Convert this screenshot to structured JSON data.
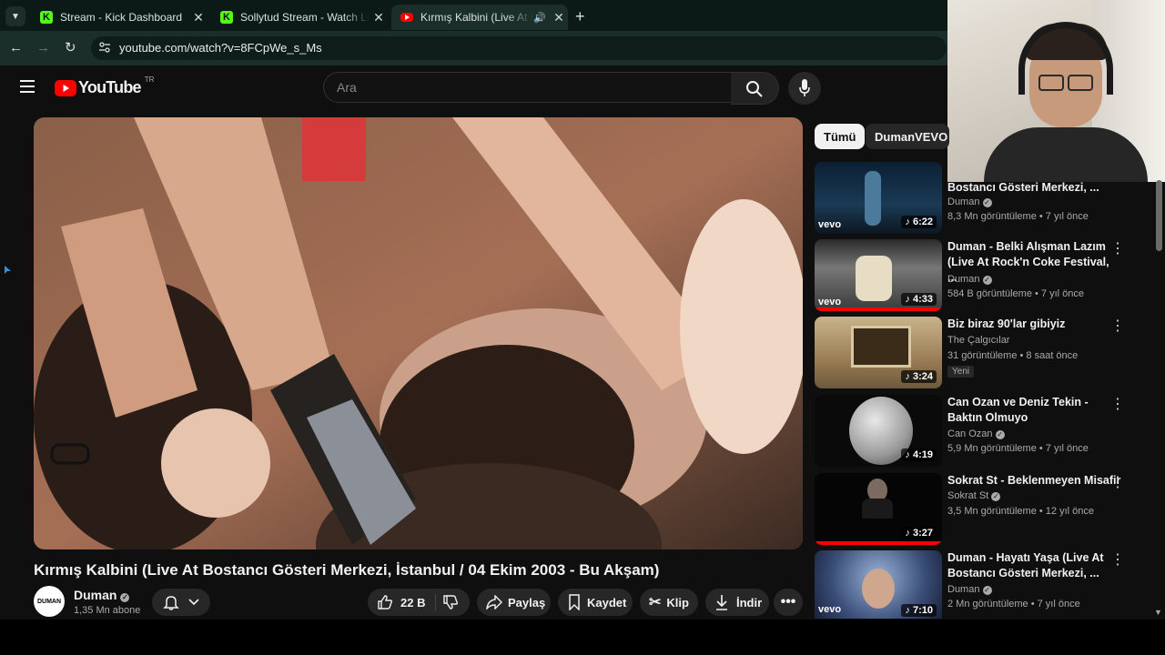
{
  "browser": {
    "tabs": [
      {
        "title": "Stream - Kick Dashboard",
        "favicon": "kick-icon"
      },
      {
        "title": "Sollytud Stream - Watch Live on Kick",
        "favicon": "kick-icon"
      },
      {
        "title": "Kırmış Kalbini (Live At Bostancı",
        "favicon": "youtube-icon",
        "active": true
      }
    ],
    "url": "youtube.com/watch?v=8FCpWe_s_Ms"
  },
  "header": {
    "logo_text": "YouTube",
    "region": "TR",
    "search_placeholder": "Ara"
  },
  "chips": [
    "Tümü",
    "DumanVEVO ad"
  ],
  "video": {
    "title": "Kırmış Kalbini (Live At Bostancı Gösteri Merkezi, İstanbul / 04 Ekim 2003 - Bu Akşam)",
    "channel": "Duman",
    "channel_avatar_text": "DUMAN",
    "subscribers": "1,35 Mn abone",
    "likes": "22 B",
    "share_label": "Paylaş",
    "save_label": "Kaydet",
    "clip_label": "Klip",
    "download_label": "İndir"
  },
  "recommendations": [
    {
      "title_lines": [
        "Bostancı Gösteri Merkezi, ..."
      ],
      "channel": "Duman",
      "verified": true,
      "meta": "8,3 Mn görüntüleme • 7 yıl önce",
      "duration": "6:22",
      "vevo": true
    },
    {
      "title_lines": [
        "Duman - Belki Alışman Lazım",
        "(Live At Rock'n Coke Festival, ..."
      ],
      "channel": "Duman",
      "verified": true,
      "meta": "584 B görüntüleme • 7 yıl önce",
      "duration": "4:33",
      "vevo": true
    },
    {
      "title_lines": [
        "Biz biraz 90'lar gibiyiz"
      ],
      "channel": "The Çalgıcılar",
      "verified": false,
      "meta": "31 görüntüleme • 8 saat önce",
      "badge": "Yeni",
      "duration": "3:24",
      "vevo": false
    },
    {
      "title_lines": [
        "Can Ozan ve Deniz Tekin -",
        "Baktın Olmuyo"
      ],
      "channel": "Can Ozan",
      "verified": true,
      "meta": "5,9 Mn görüntüleme • 7 yıl önce",
      "duration": "4:19",
      "vevo": false
    },
    {
      "title_lines": [
        "Sokrat St - Beklenmeyen Misafir"
      ],
      "channel": "Sokrat St",
      "verified": true,
      "meta": "3,5 Mn görüntüleme • 12 yıl önce",
      "duration": "3:27",
      "vevo": false
    },
    {
      "title_lines": [
        "Duman - Hayatı Yaşa (Live At",
        "Bostancı Gösteri Merkezi, ..."
      ],
      "channel": "Duman",
      "verified": true,
      "meta": "2 Mn görüntüleme • 7 yıl önce",
      "duration": "7:10",
      "vevo": true
    }
  ],
  "colors": {
    "kick_green": "#53fc18",
    "youtube_red": "#ff0000",
    "tab_bg": "#0b1a17",
    "toolbar_bg": "#1c2e2a"
  }
}
